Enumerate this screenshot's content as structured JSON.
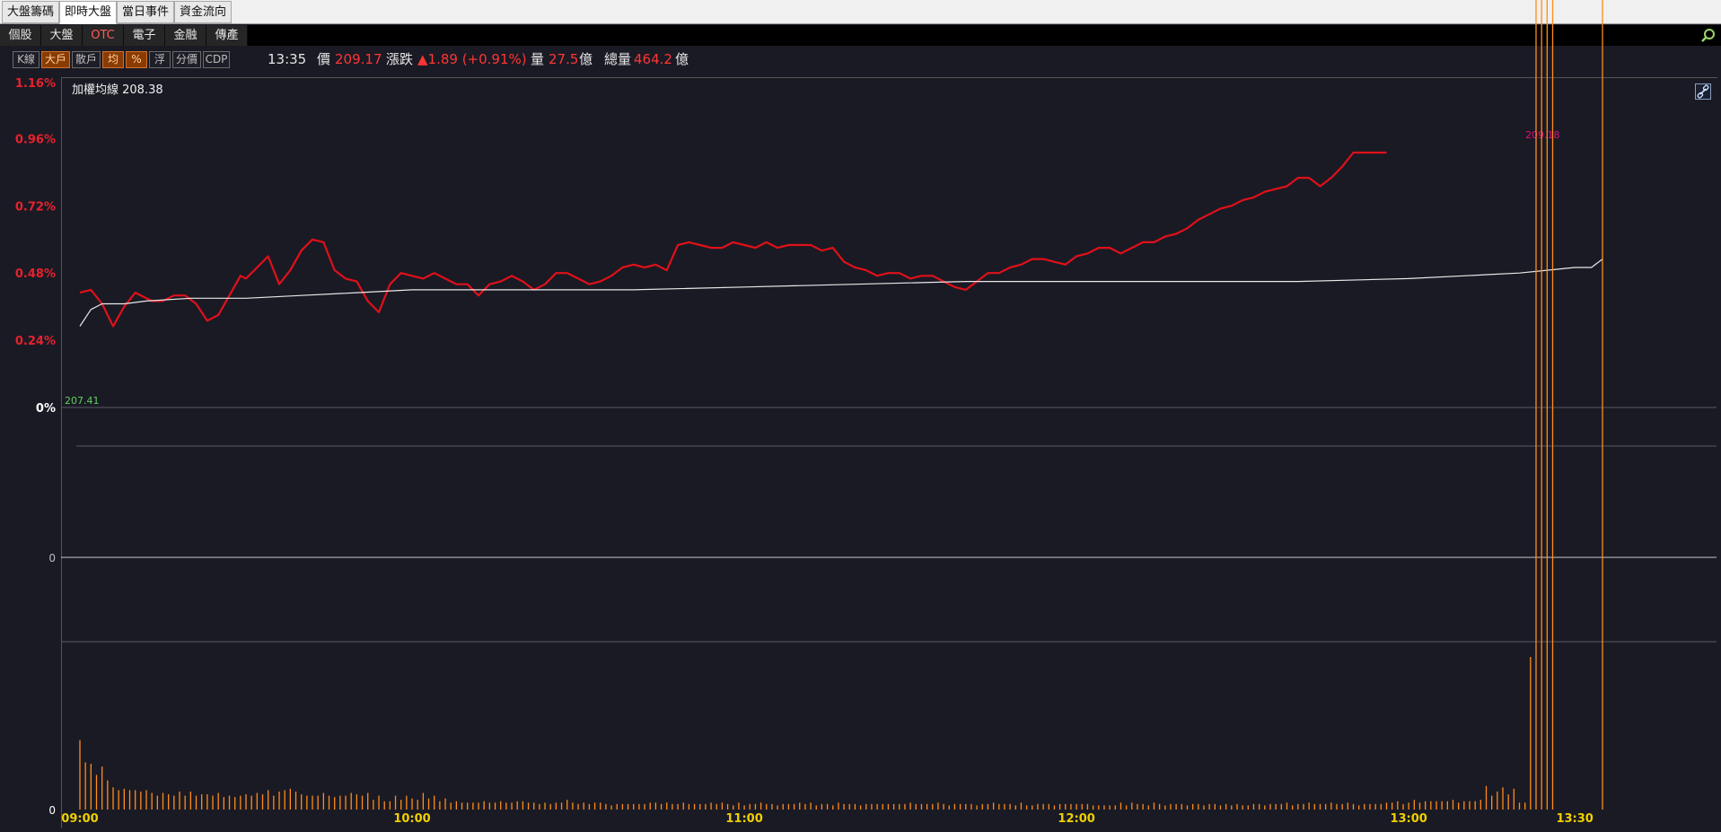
{
  "top_tabs": [
    "大盤籌碼",
    "即時大盤",
    "當日事件",
    "資金流向"
  ],
  "top_tab_active": 1,
  "sub_tabs": [
    "個股",
    "大盤",
    "OTC",
    "電子",
    "金融",
    "傳產"
  ],
  "tools": [
    {
      "label": "K線",
      "on": false
    },
    {
      "label": "大戶",
      "on": true
    },
    {
      "label": "散戶",
      "on": false
    },
    {
      "label": "均",
      "on": true
    },
    {
      "label": "%",
      "on": true
    },
    {
      "label": "浮",
      "on": false
    },
    {
      "label": "分價",
      "on": false
    },
    {
      "label": "CDP",
      "on": false
    }
  ],
  "info": {
    "time": "13:35",
    "price_label": "價",
    "price": "209.17",
    "change_label": "漲跌",
    "change": "▲1.89 (+0.91%)",
    "volume_label": "量",
    "volume": "27.5",
    "volume_unit": "億",
    "total_label": "總量",
    "total": "464.2",
    "total_unit": "億"
  },
  "colors": {
    "price_line": "#e0101a",
    "avg_line": "#e8e8e8",
    "volume_bar": "#ff8c1a",
    "up_text": "#ff3535",
    "pct_label": "#e8212d",
    "time_label": "#f0d000",
    "ref_label": "#5fd05f",
    "high_label": "#e0107a"
  },
  "icons": {
    "search": "magnify-icon",
    "link": "link-icon"
  },
  "chart_data": {
    "type": "line",
    "avg_legend": "加權均線 208.38",
    "reference_value_label": "207.41",
    "high_label": "209.18",
    "y_pct_ticks": [
      "1.16%",
      "0.96%",
      "0.72%",
      "0.48%",
      "0.24%",
      "0%"
    ],
    "y_pct_range": [
      0,
      1.16
    ],
    "osc_zero_label": "0",
    "vol_zero_label": "0",
    "x_ticks": [
      "09:00",
      "10:00",
      "11:00",
      "12:00",
      "13:00",
      "13:30"
    ],
    "x_tick_minutes": [
      0,
      60,
      120,
      180,
      240,
      270
    ],
    "x_range_minutes": [
      0,
      275
    ],
    "series": [
      {
        "key": "price",
        "x_min": [
          0,
          2,
          4,
          6,
          8,
          10,
          13,
          15,
          17,
          19,
          21,
          23,
          25,
          27,
          29,
          30,
          32,
          34,
          36,
          38,
          40,
          42,
          44,
          46,
          48,
          50,
          52,
          54,
          56,
          58,
          60,
          62,
          64,
          66,
          68,
          70,
          72,
          74,
          76,
          78,
          80,
          82,
          84,
          86,
          88,
          90,
          92,
          94,
          96,
          98,
          100,
          102,
          104,
          106,
          108,
          110,
          112,
          114,
          116,
          118,
          120,
          122,
          124,
          126,
          128,
          130,
          132,
          134,
          136,
          138,
          140,
          142,
          144,
          146,
          148,
          150,
          152,
          154,
          156,
          158,
          160,
          162,
          164,
          166,
          168,
          170,
          172,
          174,
          176,
          178,
          180,
          182,
          184,
          186,
          188,
          190,
          192,
          194,
          196,
          198,
          200,
          202,
          204,
          206,
          208,
          210,
          212,
          214,
          216,
          218,
          220,
          222,
          224,
          226,
          228,
          230,
          232,
          234,
          236,
          238,
          240,
          242,
          244,
          246,
          248,
          250,
          252,
          254,
          256,
          258,
          260,
          262,
          264,
          266,
          268,
          270,
          272,
          275
        ],
        "y_pct": [
          0.41,
          0.42,
          0.37,
          0.29,
          0.36,
          0.41,
          0.38,
          0.38,
          0.4,
          0.4,
          0.37,
          0.31,
          0.33,
          0.4,
          0.47,
          0.46,
          0.5,
          0.54,
          0.44,
          0.49,
          0.56,
          0.6,
          0.59,
          0.49,
          0.46,
          0.45,
          0.38,
          0.34,
          0.44,
          0.48,
          0.47,
          0.46,
          0.48,
          0.46,
          0.44,
          0.44,
          0.4,
          0.44,
          0.45,
          0.47,
          0.45,
          0.42,
          0.44,
          0.48,
          0.48,
          0.46,
          0.44,
          0.45,
          0.47,
          0.5,
          0.51,
          0.5,
          0.51,
          0.49,
          0.58,
          0.59,
          0.58,
          0.57,
          0.57,
          0.59,
          0.58,
          0.57,
          0.59,
          0.57,
          0.58,
          0.58,
          0.58,
          0.56,
          0.57,
          0.52,
          0.5,
          0.49,
          0.47,
          0.48,
          0.48,
          0.46,
          0.47,
          0.47,
          0.45,
          0.43,
          0.42,
          0.45,
          0.48,
          0.48,
          0.5,
          0.51,
          0.53,
          0.53,
          0.52,
          0.51,
          0.54,
          0.55,
          0.57,
          0.57,
          0.55,
          0.57,
          0.59,
          0.59,
          0.61,
          0.62,
          0.64,
          0.67,
          0.69,
          0.71,
          0.72,
          0.74,
          0.75,
          0.77,
          0.78,
          0.79,
          0.82,
          0.82,
          0.79,
          0.82,
          0.86,
          0.91,
          0.91,
          0.91,
          0.91
        ],
        "high_point": {
          "x_min": 265,
          "y_pct": 0.91
        }
      },
      {
        "key": "avg",
        "x_min": [
          0,
          2,
          4,
          8,
          12,
          20,
          30,
          40,
          50,
          60,
          70,
          80,
          100,
          120,
          140,
          160,
          180,
          200,
          220,
          240,
          250,
          260,
          265,
          270,
          273,
          275
        ],
        "y_pct": [
          0.29,
          0.35,
          0.37,
          0.37,
          0.38,
          0.39,
          0.39,
          0.4,
          0.41,
          0.42,
          0.42,
          0.42,
          0.42,
          0.43,
          0.44,
          0.45,
          0.45,
          0.45,
          0.45,
          0.46,
          0.47,
          0.48,
          0.49,
          0.5,
          0.5,
          0.53
        ]
      }
    ],
    "volume": {
      "x_min": [
        0,
        1,
        2,
        3,
        4,
        5,
        6,
        7,
        8,
        9,
        10,
        11,
        12,
        13,
        14,
        15,
        16,
        17,
        18,
        19,
        20,
        21,
        22,
        23,
        24,
        25,
        26,
        27,
        28,
        29,
        30,
        31,
        32,
        33,
        34,
        35,
        36,
        37,
        38,
        39,
        40,
        41,
        42,
        43,
        44,
        45,
        46,
        47,
        48,
        49,
        50,
        51,
        52,
        53,
        54,
        55,
        56,
        57,
        58,
        59,
        60,
        61,
        62,
        63,
        64,
        65,
        66,
        67,
        68,
        69,
        70,
        71,
        72,
        73,
        74,
        75,
        76,
        77,
        78,
        79,
        80,
        81,
        82,
        83,
        84,
        85,
        86,
        87,
        88,
        89,
        90,
        91,
        92,
        93,
        94,
        95,
        96,
        97,
        98,
        99,
        100,
        101,
        102,
        103,
        104,
        105,
        106,
        107,
        108,
        109,
        110,
        111,
        112,
        113,
        114,
        115,
        116,
        117,
        118,
        119,
        120,
        121,
        122,
        123,
        124,
        125,
        126,
        127,
        128,
        129,
        130,
        131,
        132,
        133,
        134,
        135,
        136,
        137,
        138,
        139,
        140,
        141,
        142,
        143,
        144,
        145,
        146,
        147,
        148,
        149,
        150,
        151,
        152,
        153,
        154,
        155,
        156,
        157,
        158,
        159,
        160,
        161,
        162,
        163,
        164,
        165,
        166,
        167,
        168,
        169,
        170,
        171,
        172,
        173,
        174,
        175,
        176,
        177,
        178,
        179,
        180,
        181,
        182,
        183,
        184,
        185,
        186,
        187,
        188,
        189,
        190,
        191,
        192,
        193,
        194,
        195,
        196,
        197,
        198,
        199,
        200,
        201,
        202,
        203,
        204,
        205,
        206,
        207,
        208,
        209,
        210,
        211,
        212,
        213,
        214,
        215,
        216,
        217,
        218,
        219,
        220,
        221,
        222,
        223,
        224,
        225,
        226,
        227,
        228,
        229,
        230,
        231,
        232,
        233,
        234,
        235,
        236,
        237,
        238,
        239,
        240,
        241,
        242,
        243,
        244,
        245,
        246,
        247,
        248,
        249,
        250,
        251,
        252,
        253,
        254,
        255,
        256,
        257,
        258,
        259,
        260,
        261,
        262,
        263,
        264,
        265,
        266,
        275
      ],
      "values": [
        50,
        34,
        33,
        25,
        31,
        21,
        16,
        14,
        15,
        14,
        14,
        13,
        14,
        12,
        10,
        12,
        11,
        10,
        13,
        10,
        13,
        10,
        11,
        11,
        10,
        12,
        9,
        10,
        9,
        10,
        11,
        10,
        12,
        11,
        14,
        10,
        13,
        14,
        15,
        13,
        11,
        10,
        10,
        10,
        12,
        10,
        9,
        10,
        10,
        12,
        11,
        10,
        12,
        7,
        10,
        6,
        6,
        10,
        7,
        10,
        8,
        7,
        12,
        8,
        10,
        6,
        8,
        5,
        6,
        5,
        5,
        5,
        5,
        6,
        5,
        5,
        6,
        5,
        5,
        6,
        6,
        5,
        5,
        4,
        5,
        4,
        5,
        5,
        7,
        5,
        4,
        5,
        4,
        5,
        5,
        4,
        3,
        4,
        4,
        4,
        4,
        4,
        4,
        5,
        5,
        4,
        5,
        4,
        4,
        5,
        4,
        4,
        4,
        4,
        5,
        4,
        5,
        4,
        3,
        5,
        3,
        4,
        4,
        5,
        4,
        4,
        3,
        4,
        4,
        4,
        5,
        4,
        5,
        3,
        4,
        4,
        3,
        5,
        4,
        4,
        4,
        3,
        4,
        4,
        4,
        4,
        4,
        4,
        4,
        4,
        5,
        4,
        4,
        4,
        4,
        5,
        4,
        3,
        4,
        4,
        4,
        4,
        3,
        4,
        4,
        5,
        4,
        4,
        4,
        3,
        5,
        3,
        3,
        4,
        4,
        4,
        3,
        4,
        4,
        4,
        4,
        4,
        4,
        3,
        3,
        3,
        3,
        3,
        5,
        3,
        5,
        4,
        4,
        3,
        5,
        4,
        3,
        4,
        4,
        4,
        3,
        4,
        4,
        3,
        4,
        4,
        3,
        4,
        3,
        4,
        3,
        3,
        4,
        4,
        3,
        4,
        4,
        4,
        5,
        3,
        4,
        4,
        5,
        4,
        4,
        4,
        5,
        4,
        4,
        5,
        4,
        3,
        4,
        4,
        4,
        4,
        5,
        5,
        6,
        4,
        5,
        7,
        5,
        6,
        6,
        6,
        6,
        6,
        7,
        5,
        6,
        6,
        6,
        7,
        17,
        10,
        13,
        16,
        11,
        15,
        5,
        5,
        110
      ]
    }
  }
}
